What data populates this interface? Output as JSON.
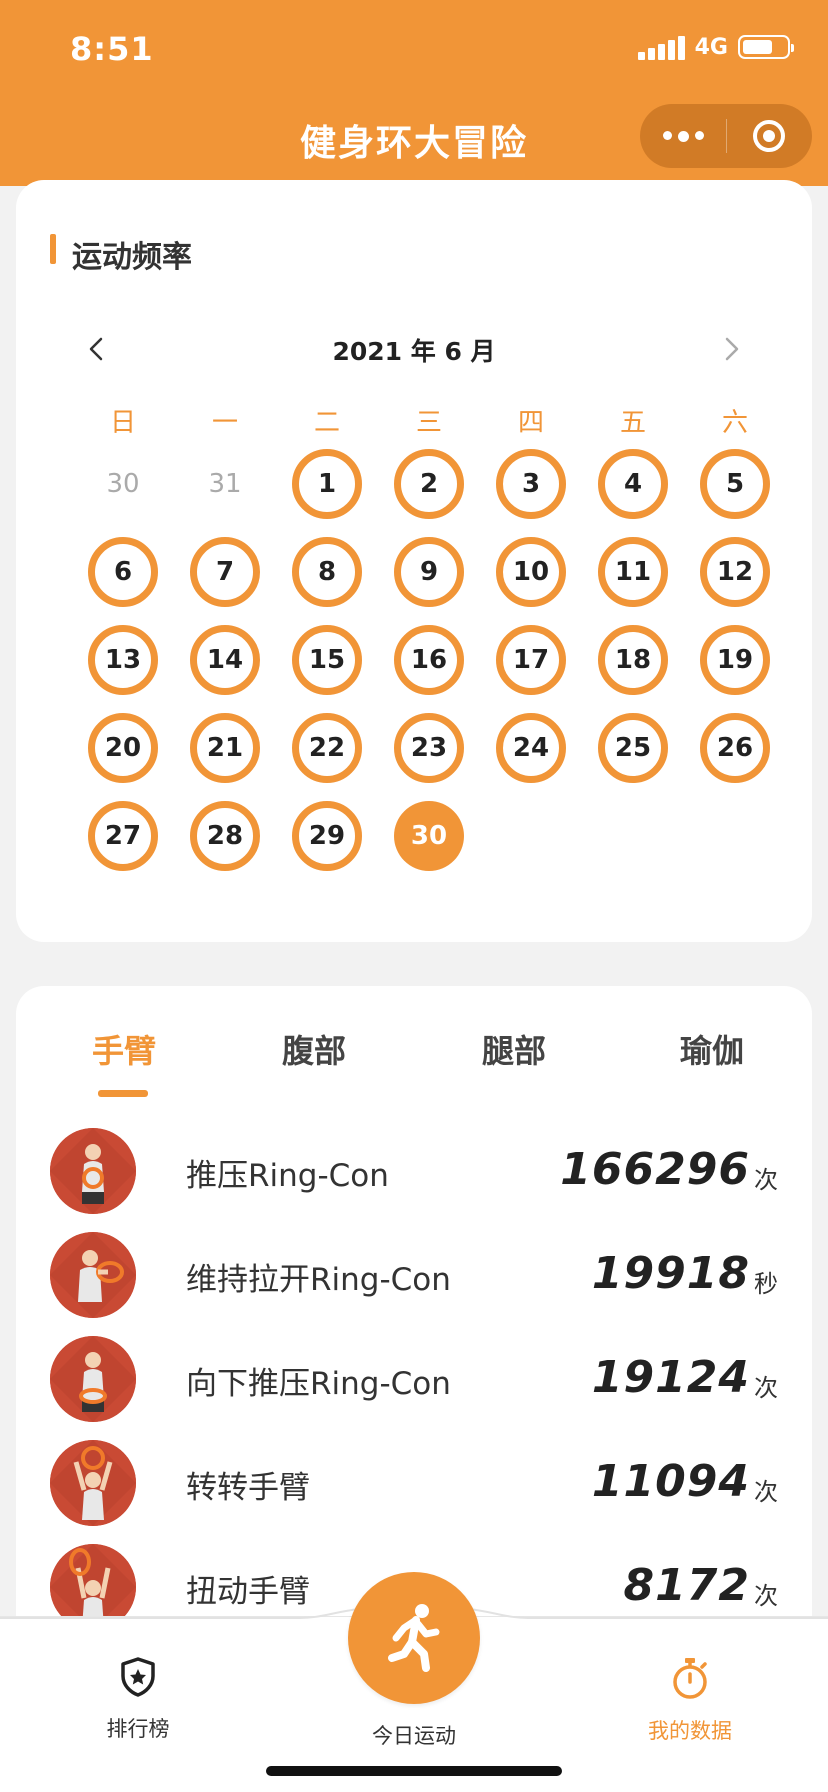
{
  "status_bar": {
    "time": "8:51",
    "network": "4G",
    "battery_level": 0.7
  },
  "header": {
    "title": "健身环大冒险"
  },
  "calendar": {
    "section_title": "运动频率",
    "month_label": "2021 年 6 月",
    "weekdays": [
      "日",
      "一",
      "二",
      "三",
      "四",
      "五",
      "六"
    ],
    "days": [
      {
        "label": "30",
        "state": "other"
      },
      {
        "label": "31",
        "state": "other"
      },
      {
        "label": "1",
        "state": "ring"
      },
      {
        "label": "2",
        "state": "ring"
      },
      {
        "label": "3",
        "state": "ring"
      },
      {
        "label": "4",
        "state": "ring"
      },
      {
        "label": "5",
        "state": "ring"
      },
      {
        "label": "6",
        "state": "ring"
      },
      {
        "label": "7",
        "state": "ring"
      },
      {
        "label": "8",
        "state": "ring"
      },
      {
        "label": "9",
        "state": "ring"
      },
      {
        "label": "10",
        "state": "ring"
      },
      {
        "label": "11",
        "state": "ring"
      },
      {
        "label": "12",
        "state": "ring"
      },
      {
        "label": "13",
        "state": "ring"
      },
      {
        "label": "14",
        "state": "ring"
      },
      {
        "label": "15",
        "state": "ring"
      },
      {
        "label": "16",
        "state": "ring"
      },
      {
        "label": "17",
        "state": "ring"
      },
      {
        "label": "18",
        "state": "ring"
      },
      {
        "label": "19",
        "state": "ring"
      },
      {
        "label": "20",
        "state": "ring"
      },
      {
        "label": "21",
        "state": "ring"
      },
      {
        "label": "22",
        "state": "ring"
      },
      {
        "label": "23",
        "state": "ring"
      },
      {
        "label": "24",
        "state": "ring"
      },
      {
        "label": "25",
        "state": "ring"
      },
      {
        "label": "26",
        "state": "ring"
      },
      {
        "label": "27",
        "state": "ring"
      },
      {
        "label": "28",
        "state": "ring"
      },
      {
        "label": "29",
        "state": "ring"
      },
      {
        "label": "30",
        "state": "today"
      }
    ]
  },
  "stats": {
    "tabs": [
      "手臂",
      "腹部",
      "腿部",
      "瑜伽"
    ],
    "active_tab": 0,
    "items": [
      {
        "label": "推压Ring-Con",
        "value": "166296",
        "unit": "次"
      },
      {
        "label": "维持拉开Ring-Con",
        "value": "19918",
        "unit": "秒"
      },
      {
        "label": "向下推压Ring-Con",
        "value": "19124",
        "unit": "次"
      },
      {
        "label": "转转手臂",
        "value": "11094",
        "unit": "次"
      },
      {
        "label": "扭动手臂",
        "value": "8172",
        "unit": "次"
      }
    ]
  },
  "tabbar": {
    "ranking": "排行榜",
    "today": "今日运动",
    "my_data": "我的数据"
  },
  "colors": {
    "accent": "#f19537",
    "avatar_bg": "#c94a34"
  }
}
